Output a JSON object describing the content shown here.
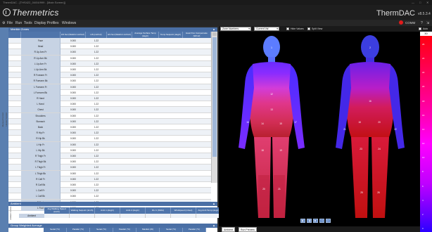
{
  "window": {
    "os_title": "ThermDAC - [THS422_04/04/999 - [Main Screen]]",
    "brand": "Thermetrics",
    "product": "ThermDAC",
    "version": "v8.5.3.4",
    "comm_label": "COMM",
    "comm_color": "#e01b1b"
  },
  "menu": {
    "items": [
      "File",
      "Run",
      "Tools",
      "Display Profiles",
      "Windows"
    ]
  },
  "manikin": {
    "section_title": "Manikin Zones",
    "side_captions": [
      "Manual Control",
      "Heater Control"
    ],
    "headers": [
      "",
      "HS Set (Watt/m²-m2/m2)",
      "HS (m2/m2)",
      "HS Set (Watt/m²-m2/m2)",
      "Average Surface Temp (degC)",
      "Temp Setpoint (degC)",
      "Heat Flux Compensate (W/m2)"
    ],
    "zones": [
      {
        "name": "Face",
        "set": "0.000",
        "area": "1.22"
      },
      {
        "name": "Head",
        "set": "0.000",
        "area": "1.22"
      },
      {
        "name": "R Up Arm Fr",
        "set": "0.000",
        "area": "1.22"
      },
      {
        "name": "R Up Arm Bk",
        "set": "0.000",
        "area": "1.22"
      },
      {
        "name": "L Up Arm Fr",
        "set": "0.000",
        "area": "1.22"
      },
      {
        "name": "L Up Arm Bk",
        "set": "0.000",
        "area": "1.22"
      },
      {
        "name": "R Forearm Fr",
        "set": "0.000",
        "area": "1.22"
      },
      {
        "name": "R Forearm Bk",
        "set": "0.000",
        "area": "1.22"
      },
      {
        "name": "L Forearm Fr",
        "set": "0.000",
        "area": "1.22"
      },
      {
        "name": "L Forearm Bk",
        "set": "0.000",
        "area": "1.22"
      },
      {
        "name": "R Hand",
        "set": "0.000",
        "area": "1.22"
      },
      {
        "name": "L Hand",
        "set": "0.000",
        "area": "1.22"
      },
      {
        "name": "Chest",
        "set": "0.000",
        "area": "1.22"
      },
      {
        "name": "Shoulders",
        "set": "0.000",
        "area": "1.22"
      },
      {
        "name": "Stomach",
        "set": "0.000",
        "area": "1.22"
      },
      {
        "name": "Back",
        "set": "0.000",
        "area": "1.22"
      },
      {
        "name": "R Hip Fr",
        "set": "0.000",
        "area": "1.22"
      },
      {
        "name": "R Hip Bk",
        "set": "0.000",
        "area": "1.22"
      },
      {
        "name": "L Hip Fr",
        "set": "0.000",
        "area": "1.22"
      },
      {
        "name": "L Hip Bk",
        "set": "0.000",
        "area": "1.22"
      },
      {
        "name": "R Thigh Fr",
        "set": "0.000",
        "area": "1.22"
      },
      {
        "name": "R Thigh Bk",
        "set": "0.000",
        "area": "1.22"
      },
      {
        "name": "L Thigh Fr",
        "set": "0.000",
        "area": "1.22"
      },
      {
        "name": "L Thigh Bk",
        "set": "0.000",
        "area": "1.22"
      },
      {
        "name": "R Calf Fr",
        "set": "0.000",
        "area": "1.22"
      },
      {
        "name": "R Calf Bk",
        "set": "0.000",
        "area": "1.22"
      },
      {
        "name": "L Calf Fr",
        "set": "0.000",
        "area": "1.22"
      },
      {
        "name": "L Calf Bk",
        "set": "0.000",
        "area": "1.22"
      },
      {
        "name": "R Foot",
        "set": "0.000",
        "area": "1.22"
      },
      {
        "name": "L Foot",
        "set": "0.000",
        "area": "1.22"
      }
    ]
  },
  "ambient": {
    "section_title": "Ambient",
    "side_caption": "Ambient Control",
    "row_label": "Ambient",
    "headers": [
      "Avg Walking Speed (km/h)",
      "Walking Setpoint (km/h)",
      "Amb 1 (degC)",
      "Amb 2 (degC)",
      "RH 1 (%RH)",
      "Windspeed (m/sec)",
      "Avg Amb Temp (degC)"
    ]
  },
  "gwa": {
    "section_title": "Group Weighted Average",
    "headers": [
      "Serial (°C)",
      "Parallel (°C)",
      "Serial (°C)",
      "Parallel (°C)",
      "Manikin (W)",
      "Serial (°C)",
      "Parallel (°C)"
    ]
  },
  "viewer": {
    "select1": "Zone Numbers",
    "select2": "Current Val",
    "check1": "Hide Values",
    "check2": "Split View",
    "auto_label": "Auto",
    "legend_max": "30",
    "legend_ticks": [
      "26",
      "24",
      "22",
      "20",
      "18",
      "16",
      "14",
      "12",
      "10",
      "8",
      "6",
      "4",
      "2",
      "0"
    ],
    "front_zone_labels": [
      "1",
      "12",
      "13",
      "14",
      "15",
      "16",
      "17",
      "18",
      "19",
      "20",
      "21",
      "22",
      "23",
      "24",
      "25",
      "26",
      "27",
      "28",
      "29",
      "30"
    ],
    "back_zone_labels": [
      "2",
      "16",
      "18",
      "20",
      "21",
      "22",
      "23",
      "24",
      "25",
      "26",
      "27",
      "28"
    ],
    "tabs": [
      "Ambient",
      "Run Preview"
    ],
    "view_buttons": [
      "◧",
      "◨",
      "▶",
      "◁",
      "▷"
    ]
  }
}
